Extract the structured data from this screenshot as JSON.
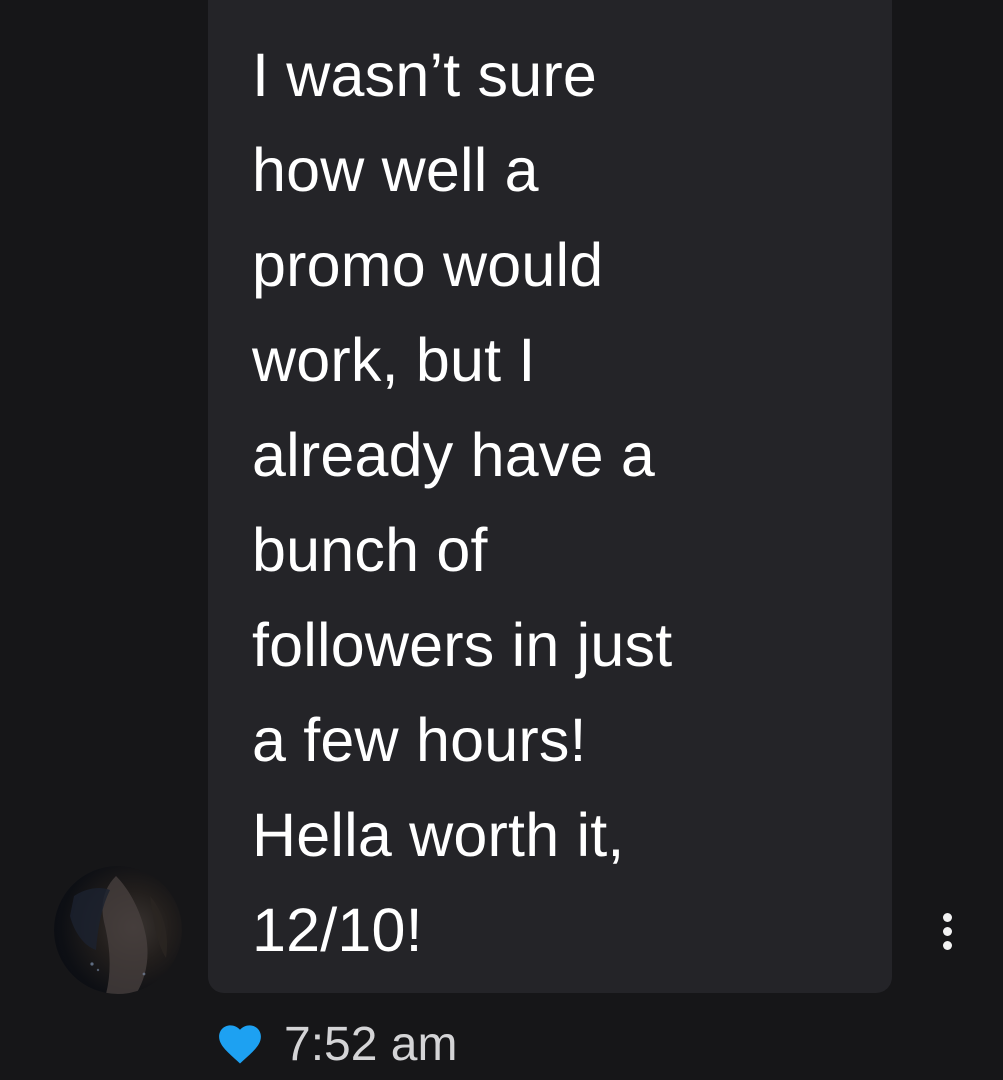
{
  "message": {
    "lines": [
      "I wasn’t sure",
      "how well a",
      "promo would",
      "work, but I",
      "already have a",
      "bunch of",
      "followers in just",
      "a few hours!",
      "Hella worth it,",
      "12/10!"
    ],
    "timestamp": "7:52 am",
    "liked": true
  },
  "icons": {
    "like": "heart-icon",
    "more": "more-vertical-icon"
  },
  "colors": {
    "background": "#161618",
    "bubble": "#242428",
    "text": "#ffffff",
    "heart": "#1da1f2",
    "timestamp": "#d4d4d6"
  }
}
